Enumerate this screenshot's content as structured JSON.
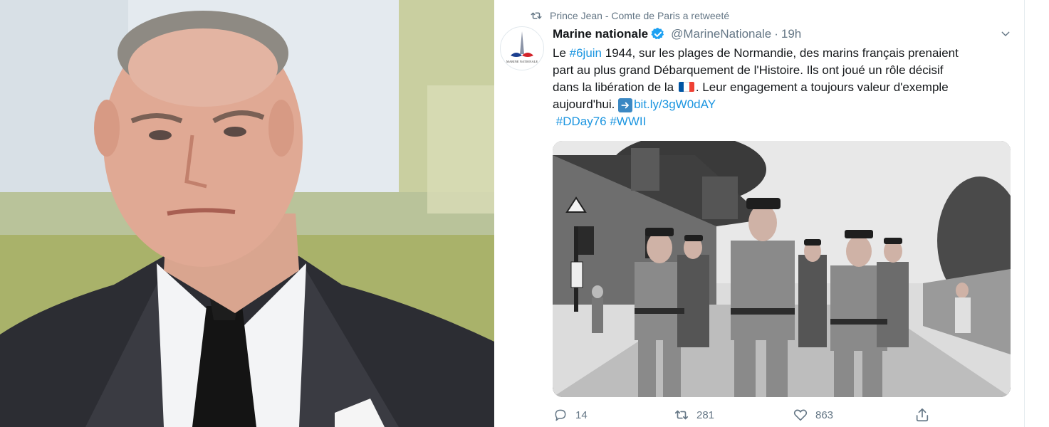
{
  "retweet": {
    "label": "Prince Jean - Comte de Paris a retweeté",
    "icon": "retweet-icon"
  },
  "author": {
    "display_name": "Marine nationale",
    "handle": "@MarineNationale",
    "separator": "·",
    "time": "19h",
    "verified": true,
    "avatar_text": "MARINE NATIONALE"
  },
  "tweet": {
    "segments": {
      "le": "Le ",
      "hashtag_6juin": "#6juin",
      "line1_rest": " 1944, sur les plages de Normandie, des marins français prenaient",
      "line2": "part au plus grand Débarquement de l'Histoire. Ils ont joué un rôle décisif",
      "line3_start": "dans la libération de la ",
      "line3_end": ". Leur engagement a toujours valeur d'exemple",
      "line4_start": "aujourd'hui. ",
      "short_link": "bit.ly/3gW0dAY",
      "hashtag_dday": "#DDay76",
      "hashtag_ww2": "#WWII"
    },
    "flag_colors": [
      "#0055A4",
      "#FFFFFF",
      "#EF4135"
    ]
  },
  "stats": {
    "replies": "14",
    "retweets": "281",
    "likes": "863"
  },
  "colors": {
    "link": "#1b95e0",
    "muted": "#657786",
    "text": "#14171a",
    "verified": "#1da1f2"
  }
}
